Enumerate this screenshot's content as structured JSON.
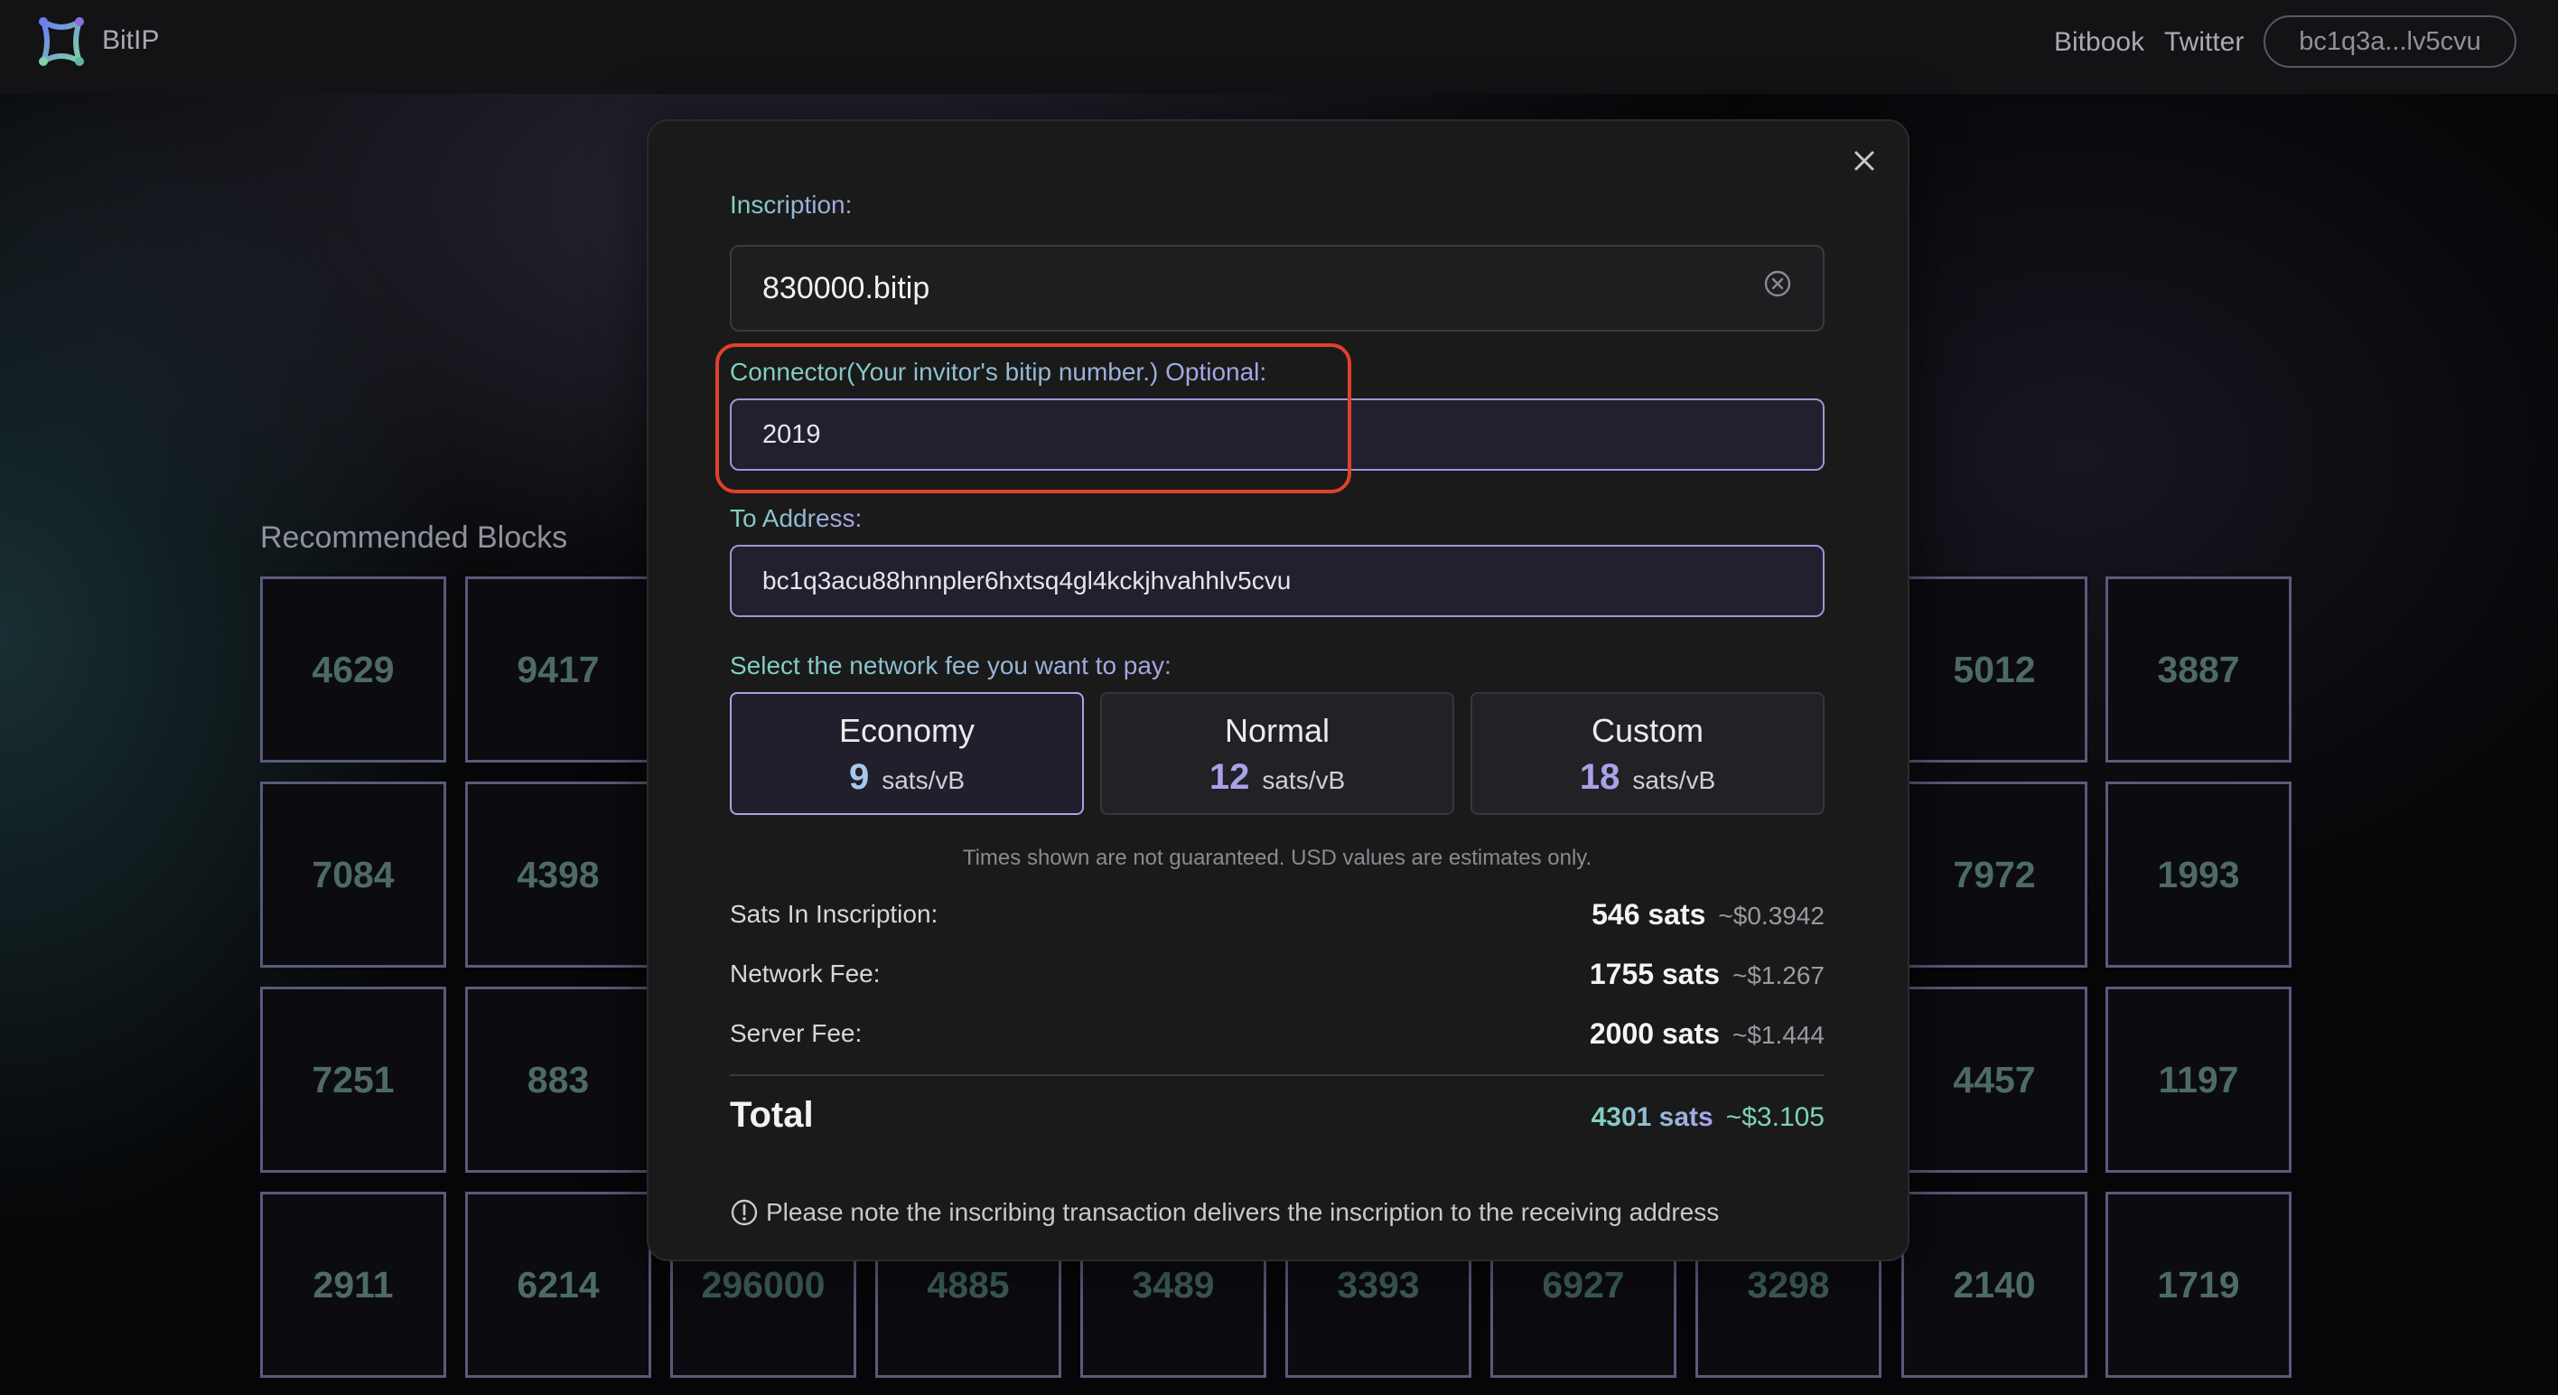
{
  "header": {
    "app_name": "BitIP",
    "nav": [
      "Bitbook",
      "Twitter"
    ],
    "wallet_address": "bc1q3a...lv5cvu"
  },
  "section": {
    "title": "Recommended Blocks"
  },
  "grid": {
    "rows": [
      [
        "4629",
        "9417",
        "5012",
        "3887"
      ],
      [
        "7084",
        "4398",
        "7972",
        "1993"
      ],
      [
        "7251",
        "883",
        "4457",
        "1197"
      ],
      [
        "2911",
        "6214",
        "296000",
        "4885",
        "3489",
        "3393",
        "6927",
        "3298",
        "2140",
        "1719"
      ]
    ]
  },
  "modal": {
    "inscription_label": "Inscription:",
    "inscription_value": "830000.bitip",
    "connector_label": "Connector(Your invitor's bitip number.) Optional:",
    "connector_value": "2019",
    "address_label": "To Address:",
    "address_value": "bc1q3acu88hnnpler6hxtsq4gl4kckjhvahhlv5cvu",
    "fee_label": "Select the network fee you want to pay:",
    "fee_options": [
      {
        "name": "Economy",
        "rate": "9",
        "unit": "sats/vB",
        "selected": true
      },
      {
        "name": "Normal",
        "rate": "12",
        "unit": "sats/vB",
        "selected": false
      },
      {
        "name": "Custom",
        "rate": "18",
        "unit": "sats/vB",
        "selected": false
      }
    ],
    "disclaimer": "Times shown are not guaranteed. USD values are estimates only.",
    "costs": [
      {
        "label": "Sats In Inscription:",
        "sats": "546 sats",
        "usd": "~$0.3942"
      },
      {
        "label": "Network Fee:",
        "sats": "1755 sats",
        "usd": "~$1.267"
      },
      {
        "label": "Server Fee:",
        "sats": "2000 sats",
        "usd": "~$1.444"
      }
    ],
    "total_label": "Total",
    "total_sats": "4301 sats",
    "total_usd": "~$3.105",
    "warning": "Please note the inscribing transaction delivers the inscription to the receiving address"
  },
  "colors": {
    "accent_teal": "#7ed3c0",
    "accent_purple": "#a8a3e8",
    "highlight_red": "#e0402e"
  }
}
